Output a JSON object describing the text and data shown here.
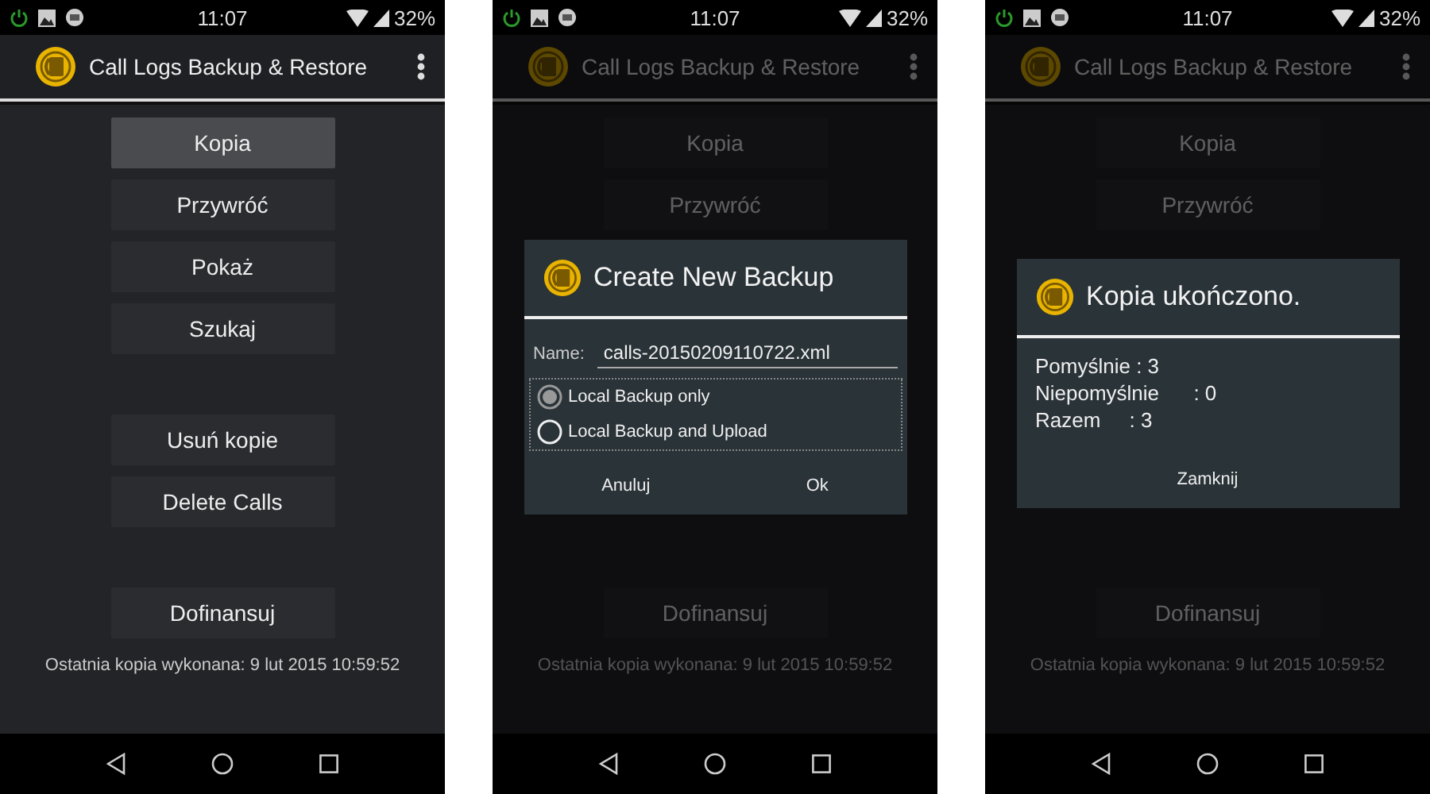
{
  "phones": [
    {
      "status": {
        "time": "11:07",
        "battery": "32%"
      },
      "app_title": "Call Logs Backup & Restore",
      "menu_top": [
        {
          "label": "Kopia",
          "selected": true
        },
        {
          "label": "Przywróć",
          "selected": false
        },
        {
          "label": "Pokaż",
          "selected": false
        },
        {
          "label": "Szukaj",
          "selected": false
        },
        {
          "label": "Usuń kopie",
          "selected": false
        },
        {
          "label": "Delete Calls",
          "selected": false
        }
      ],
      "menu_bottom": [
        {
          "label": "Dofinansuj",
          "selected": false
        }
      ],
      "last_backup": "Ostatnia kopia wykonana: 9 lut 2015 10:59:52"
    },
    {
      "status": {
        "time": "11:07",
        "battery": "32%"
      },
      "app_title": "Call Logs Backup & Restore",
      "menu_top": [
        {
          "label": "Kopia",
          "selected": false
        },
        {
          "label": "Przywróć",
          "selected": false
        }
      ],
      "menu_bottom": [
        {
          "label": "Dofinansuj",
          "selected": false
        }
      ],
      "last_backup": "Ostatnia kopia wykonana: 9 lut 2015 10:59:52",
      "dialog": {
        "kind": "backup",
        "title": "Create New Backup",
        "name_label": "Name:",
        "name_value": "calls-20150209110722.xml",
        "options": [
          {
            "label": "Local Backup only",
            "selected": true
          },
          {
            "label": "Local Backup and Upload",
            "selected": false
          }
        ],
        "buttons": [
          "Anuluj",
          "Ok"
        ]
      }
    },
    {
      "status": {
        "time": "11:07",
        "battery": "32%"
      },
      "app_title": "Call Logs Backup & Restore",
      "menu_top": [
        {
          "label": "Kopia",
          "selected": false
        },
        {
          "label": "Przywróć",
          "selected": false
        }
      ],
      "menu_bottom": [
        {
          "label": "Dofinansuj",
          "selected": false
        }
      ],
      "last_backup": "Ostatnia kopia wykonana: 9 lut 2015 10:59:52",
      "dialog": {
        "kind": "result",
        "title": "Kopia ukończono.",
        "lines": [
          "Pomyślnie : 3",
          "Niepomyślnie      : 0",
          "Razem     : 3"
        ],
        "buttons": [
          "Zamknij"
        ]
      }
    }
  ]
}
